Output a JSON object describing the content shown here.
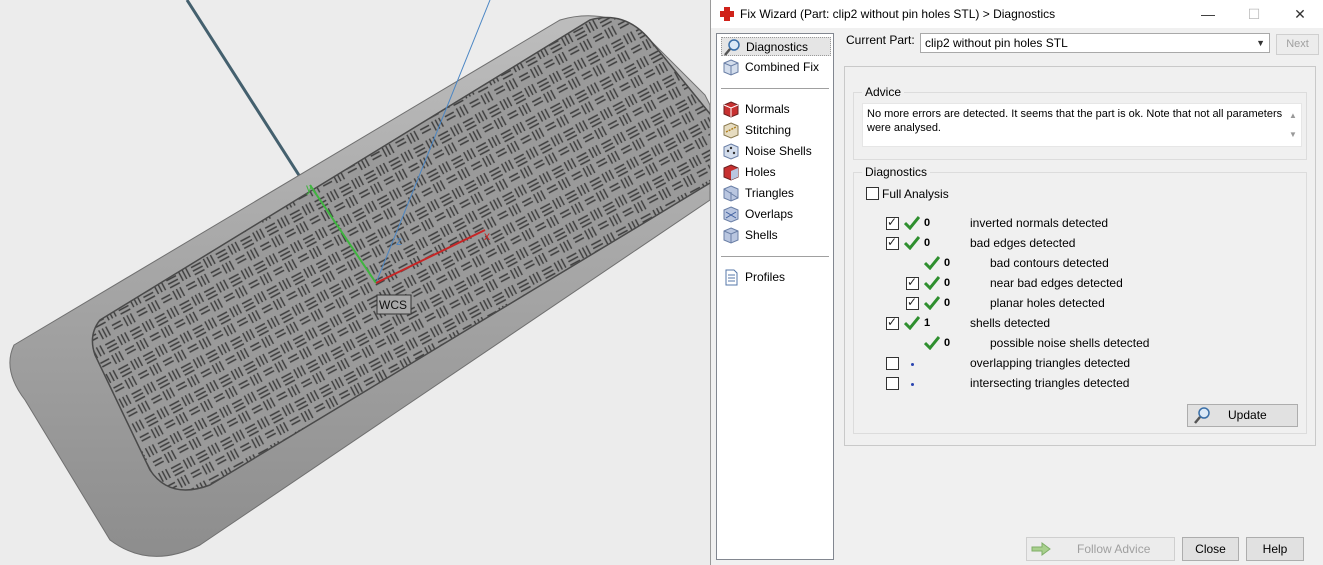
{
  "viewport": {
    "wcs_label": "WCS",
    "axis_x": "x",
    "axis_y": "y",
    "axis_z": "z"
  },
  "window": {
    "title": "Fix Wizard (Part: clip2 without pin holes STL) > Diagnostics",
    "minimize": "—",
    "maximize": "☐",
    "close": "✕"
  },
  "nav": {
    "items": [
      {
        "label": "Diagnostics"
      },
      {
        "label": "Combined Fix"
      },
      {
        "label": "Normals"
      },
      {
        "label": "Stitching"
      },
      {
        "label": "Noise Shells"
      },
      {
        "label": "Holes"
      },
      {
        "label": "Triangles"
      },
      {
        "label": "Overlaps"
      },
      {
        "label": "Shells"
      },
      {
        "label": "Profiles"
      }
    ]
  },
  "current_part": {
    "label": "Current Part:",
    "value": "clip2 without pin holes STL",
    "next": "Next"
  },
  "advice": {
    "title": "Advice",
    "text": "No more errors are detected. It seems that the part is ok. Note that not all parameters were analysed."
  },
  "diagnostics": {
    "title": "Diagnostics",
    "full_analysis": "Full Analysis",
    "rows": [
      {
        "count": "0",
        "label": "inverted normals detected"
      },
      {
        "count": "0",
        "label": "bad edges detected"
      },
      {
        "count": "0",
        "label": "bad contours detected"
      },
      {
        "count": "0",
        "label": "near bad edges detected"
      },
      {
        "count": "0",
        "label": "planar holes detected"
      },
      {
        "count": "1",
        "label": "shells detected"
      },
      {
        "count": "0",
        "label": "possible noise shells detected"
      },
      {
        "count": "",
        "label": "overlapping triangles detected"
      },
      {
        "count": "",
        "label": "intersecting triangles detected"
      }
    ],
    "update": "Update"
  },
  "footer": {
    "follow_advice": "Follow Advice",
    "close": "Close",
    "help": "Help"
  }
}
